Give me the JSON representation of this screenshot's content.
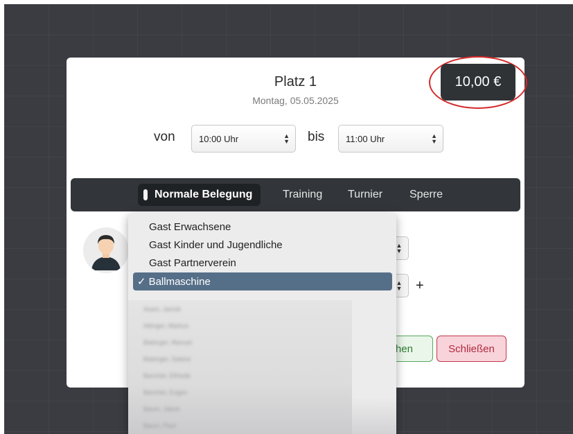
{
  "modal": {
    "court_name": "Platz 1",
    "date": "Montag, 05.05.2025",
    "price": "10,00 €",
    "from_label": "von",
    "from_value": "10:00 Uhr",
    "to_label": "bis",
    "to_value": "11:00 Uhr"
  },
  "tabs": [
    {
      "label": "Normale Belegung",
      "active": true
    },
    {
      "label": "Training",
      "active": false
    },
    {
      "label": "Turnier",
      "active": false
    },
    {
      "label": "Sperre",
      "active": false
    }
  ],
  "player_dropdown": {
    "options": [
      "Gast Erwachsene",
      "Gast Kinder und Jugendliche",
      "Gast Partnerverein"
    ],
    "selected": "Ballmaschine",
    "selected_check": "✓",
    "members_blurred": [
      "Asam, Jannik",
      "Attinger, Markus",
      "Babinger, Manuel",
      "Babinger, Sabine",
      "Barchiel, Elfriede",
      "Barchiel, Eugen",
      "Baum, Jakob",
      "Baum, Paul"
    ]
  },
  "add_player_symbol": "+",
  "buttons": {
    "book": "uchen",
    "close": "Schließen"
  },
  "colors": {
    "price_badge": "#2f3336",
    "highlight_ring": "#d42a2a",
    "selected_option": "#566f88",
    "close_button": "#b02a3f",
    "book_button": "#2f7a2f"
  }
}
